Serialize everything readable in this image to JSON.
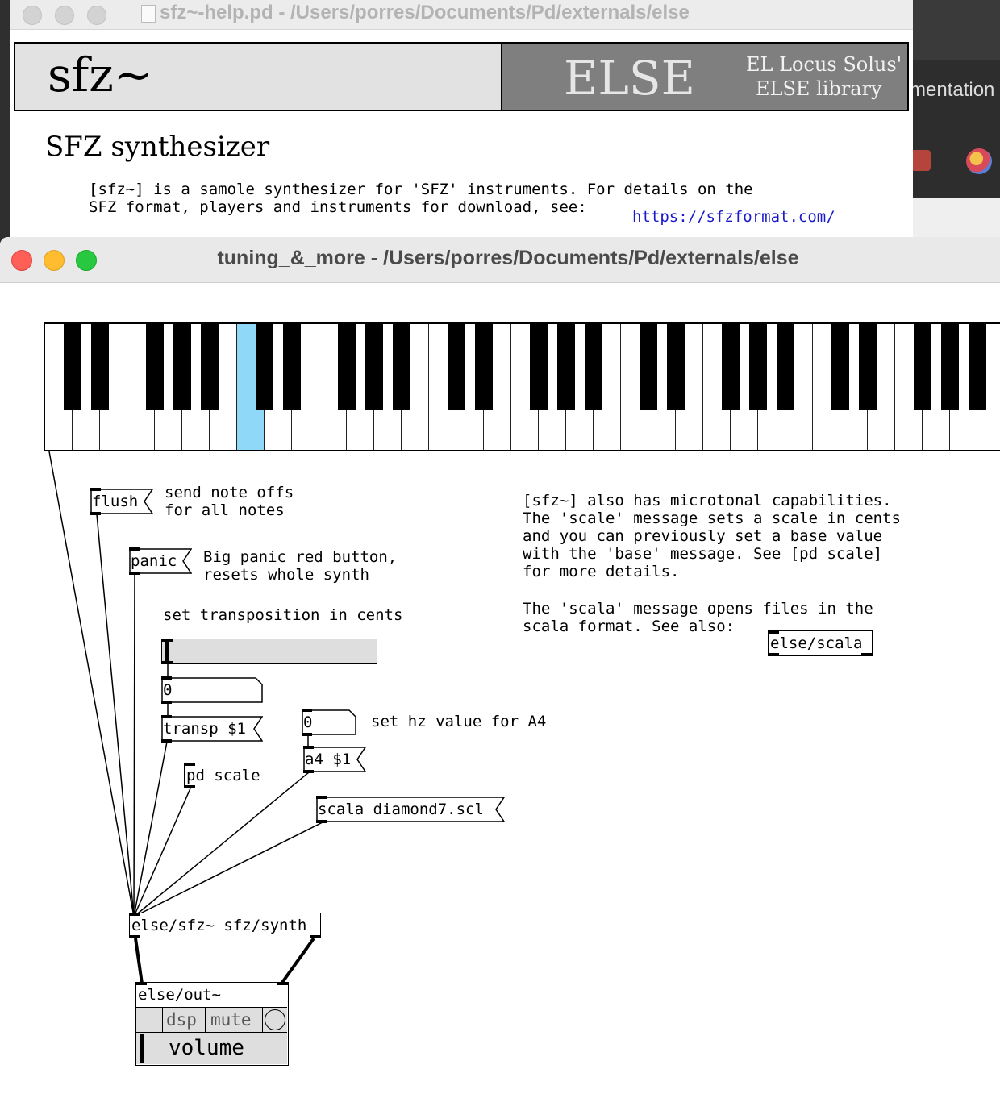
{
  "back_window": {
    "title": "sfz~-help.pd - /Users/porres/Documents/Pd/externals/else",
    "header_title": "sfz~",
    "brand": "ELSE",
    "brand_line1": "EL Locus Solus'",
    "brand_line2": "ELSE library",
    "section_title": "SFZ synthesizer",
    "description_line1": "[sfz~] is a samole synthesizer for 'SFZ' instruments. For details on the",
    "description_line2": "SFZ format, players and instruments for download, see:",
    "link": "https://sfzformat.com/"
  },
  "side_window": {
    "partial_text": "mentation"
  },
  "front_window": {
    "title": "tuning_&_more - /Users/porres/Documents/Pd/externals/else"
  },
  "keyboard": {
    "white_key_count": 35,
    "active_white_key_index": 7,
    "active_color": "#90d8f8"
  },
  "patch": {
    "flush_msg": "flush",
    "flush_comment": "send note offs\nfor all notes",
    "panic_msg": "panic",
    "panic_comment": "Big panic red button,\nresets whole synth",
    "transposition_comment": "set transposition in cents",
    "transp_number": "0",
    "transp_msg": "transp $1",
    "a4_number": "0",
    "a4_comment": "set hz value for A4",
    "a4_msg": "a4 $1",
    "pd_scale_obj": "pd scale",
    "scala_msg": "scala diamond7.scl",
    "microtonal_comment": "[sfz~] also has microtonal capabilities.\nThe 'scale' message sets a scale in cents\nand you can previously set a base value\nwith the 'base' message. See [pd scale]\nfor more details.",
    "scala_comment": "The 'scala' message opens files in the\nscala format. See also:",
    "else_scala_obj": "else/scala",
    "sfz_obj": "else/sfz~ sfz/synth",
    "out_obj": "else/out~",
    "out_dsp": "dsp",
    "out_mute": "mute",
    "out_volume": "volume"
  }
}
